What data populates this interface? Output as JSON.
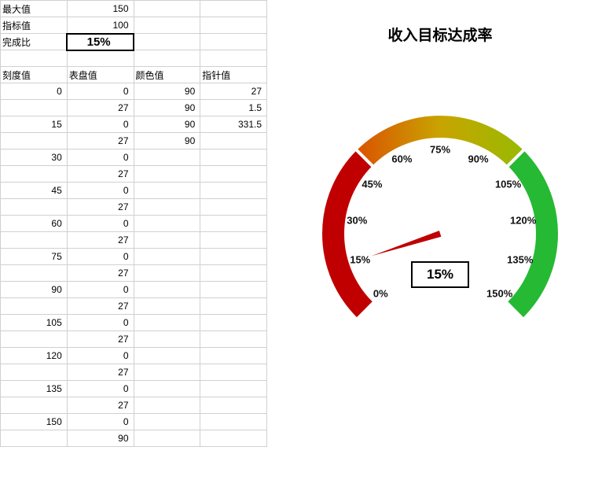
{
  "spreadsheet": {
    "max_label": "最大值",
    "max_value": "150",
    "target_label": "指标值",
    "target_value": "100",
    "completion_label": "完成比",
    "completion_value": "15%",
    "headers": {
      "scale": "刻度值",
      "dial": "表盘值",
      "color": "颜色值",
      "needle": "指针值"
    },
    "rows": [
      {
        "scale": "0",
        "dial": "0",
        "color": "90",
        "needle": "27"
      },
      {
        "scale": "",
        "dial": "27",
        "color": "90",
        "needle": "1.5"
      },
      {
        "scale": "15",
        "dial": "0",
        "color": "90",
        "needle": "331.5"
      },
      {
        "scale": "",
        "dial": "27",
        "color": "90",
        "needle": ""
      },
      {
        "scale": "30",
        "dial": "0",
        "color": "",
        "needle": ""
      },
      {
        "scale": "",
        "dial": "27",
        "color": "",
        "needle": ""
      },
      {
        "scale": "45",
        "dial": "0",
        "color": "",
        "needle": ""
      },
      {
        "scale": "",
        "dial": "27",
        "color": "",
        "needle": ""
      },
      {
        "scale": "60",
        "dial": "0",
        "color": "",
        "needle": ""
      },
      {
        "scale": "",
        "dial": "27",
        "color": "",
        "needle": ""
      },
      {
        "scale": "75",
        "dial": "0",
        "color": "",
        "needle": ""
      },
      {
        "scale": "",
        "dial": "27",
        "color": "",
        "needle": ""
      },
      {
        "scale": "90",
        "dial": "0",
        "color": "",
        "needle": ""
      },
      {
        "scale": "",
        "dial": "27",
        "color": "",
        "needle": ""
      },
      {
        "scale": "105",
        "dial": "0",
        "color": "",
        "needle": ""
      },
      {
        "scale": "",
        "dial": "27",
        "color": "",
        "needle": ""
      },
      {
        "scale": "120",
        "dial": "0",
        "color": "",
        "needle": ""
      },
      {
        "scale": "",
        "dial": "27",
        "color": "",
        "needle": ""
      },
      {
        "scale": "135",
        "dial": "0",
        "color": "",
        "needle": ""
      },
      {
        "scale": "",
        "dial": "27",
        "color": "",
        "needle": ""
      },
      {
        "scale": "150",
        "dial": "0",
        "color": "",
        "needle": ""
      },
      {
        "scale": "",
        "dial": "90",
        "color": "",
        "needle": ""
      }
    ]
  },
  "chart": {
    "title": "收入目标达成率",
    "display_value": "15%",
    "ticks": [
      "0%",
      "15%",
      "30%",
      "45%",
      "60%",
      "75%",
      "90%",
      "105%",
      "120%",
      "135%",
      "150%"
    ]
  },
  "chart_data": {
    "type": "gauge",
    "title": "收入目标达成率",
    "value_percent": 15,
    "min": 0,
    "max": 150,
    "start_angle_deg": 225,
    "end_angle_deg": -45,
    "tick_labels": [
      "0%",
      "15%",
      "30%",
      "45%",
      "60%",
      "75%",
      "90%",
      "105%",
      "120%",
      "135%",
      "150%"
    ],
    "arc_segments": [
      {
        "from": 0,
        "to": 50,
        "color": "#C00000"
      },
      {
        "from": 50,
        "to": 100,
        "color_gradient": [
          "#D85A00",
          "#9CB800"
        ]
      },
      {
        "from": 100,
        "to": 150,
        "color": "#26B934"
      }
    ],
    "needle_color": "#C00000"
  }
}
